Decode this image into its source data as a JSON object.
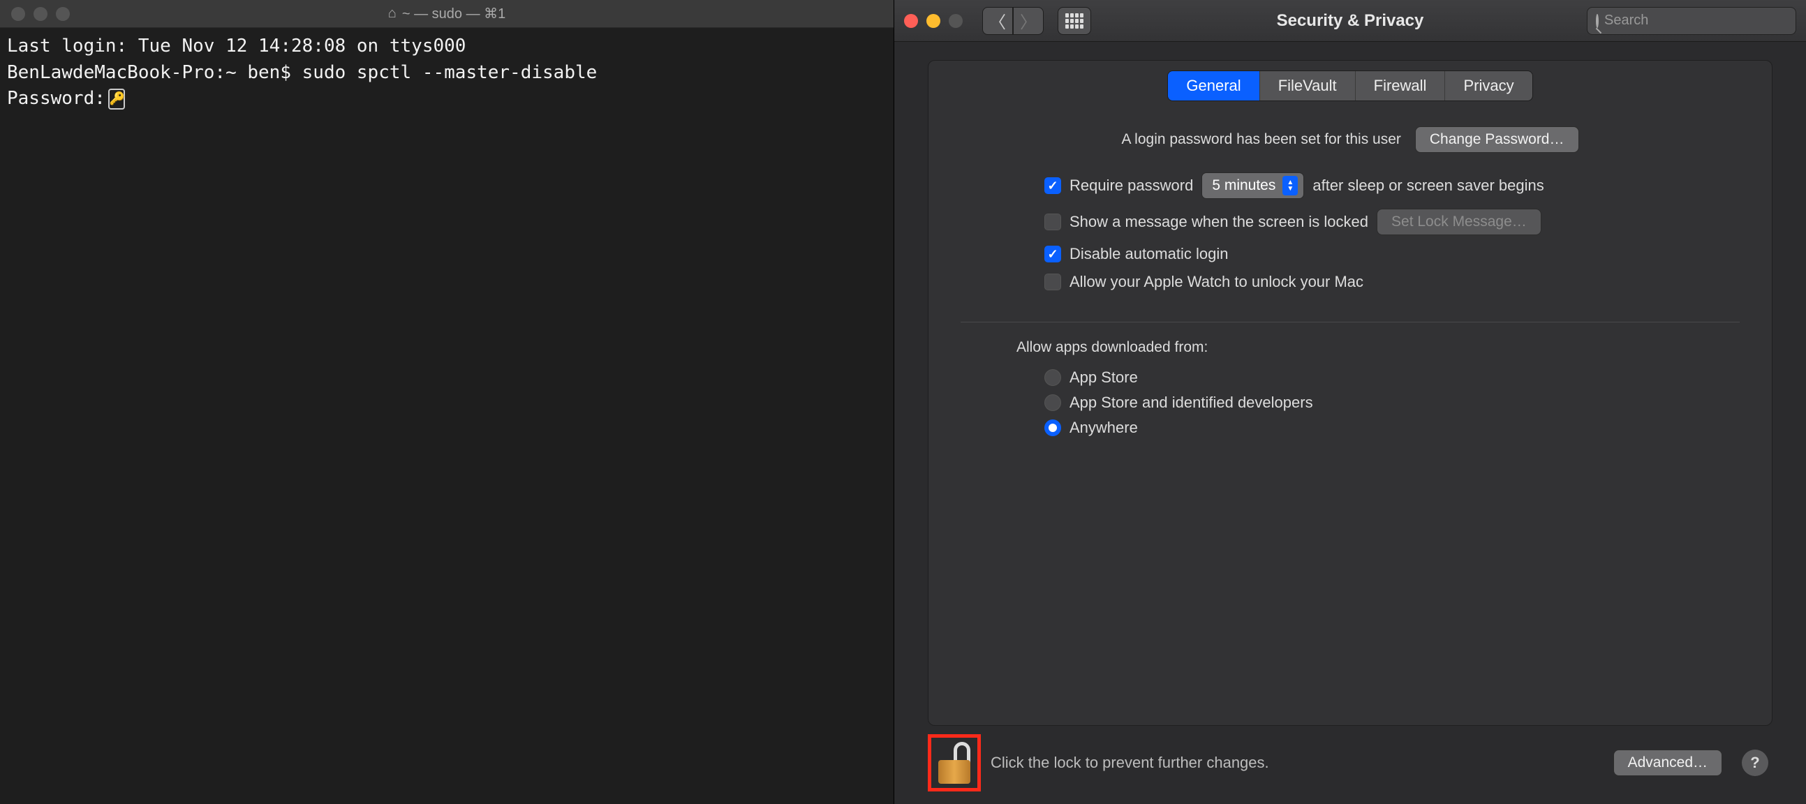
{
  "terminal": {
    "title": "~ — sudo — ⌘1",
    "line1": "Last login: Tue Nov 12 14:28:08 on ttys000",
    "line2": "BenLawdeMacBook-Pro:~ ben$ sudo spctl --master-disable",
    "line3_prefix": "Password:"
  },
  "syspref": {
    "title": "Security & Privacy",
    "search_placeholder": "Search",
    "tabs": {
      "general": "General",
      "filevault": "FileVault",
      "firewall": "Firewall",
      "privacy": "Privacy"
    },
    "login_msg": "A login password has been set for this user",
    "change_pw_btn": "Change Password…",
    "require_pw_label": "Require password",
    "require_pw_value": "5 minutes",
    "require_pw_after": "after sleep or screen saver begins",
    "show_msg_label": "Show a message when the screen is locked",
    "set_lock_msg_btn": "Set Lock Message…",
    "disable_auto_login": "Disable automatic login",
    "apple_watch": "Allow your Apple Watch to unlock your Mac",
    "allow_apps_heading": "Allow apps downloaded from:",
    "radio_appstore": "App Store",
    "radio_identified": "App Store and identified developers",
    "radio_anywhere": "Anywhere",
    "lock_text": "Click the lock to prevent further changes.",
    "advanced_btn": "Advanced…",
    "help": "?"
  }
}
